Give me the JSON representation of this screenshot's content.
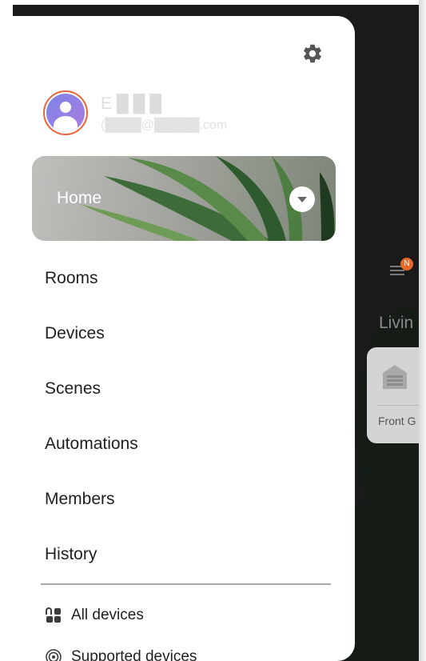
{
  "drawer": {
    "user": {
      "name": "E █ █ █",
      "email": "(████@█████.com"
    },
    "home_label": "Home",
    "nav_items": [
      {
        "label": "Rooms"
      },
      {
        "label": "Devices"
      },
      {
        "label": "Scenes"
      },
      {
        "label": "Automations"
      },
      {
        "label": "Members"
      },
      {
        "label": "History"
      }
    ],
    "bottom_items": [
      {
        "label": "All devices",
        "icon": "all-devices-icon"
      },
      {
        "label": "Supported devices",
        "icon": "supported-devices-icon"
      }
    ]
  },
  "background": {
    "notification_badge": "N",
    "room_label": "Livin",
    "device_card_label": "Front G"
  },
  "colors": {
    "accent": "#e46b2a",
    "avatar_ring": "#e8663c",
    "text_primary": "#1f1f1f"
  }
}
